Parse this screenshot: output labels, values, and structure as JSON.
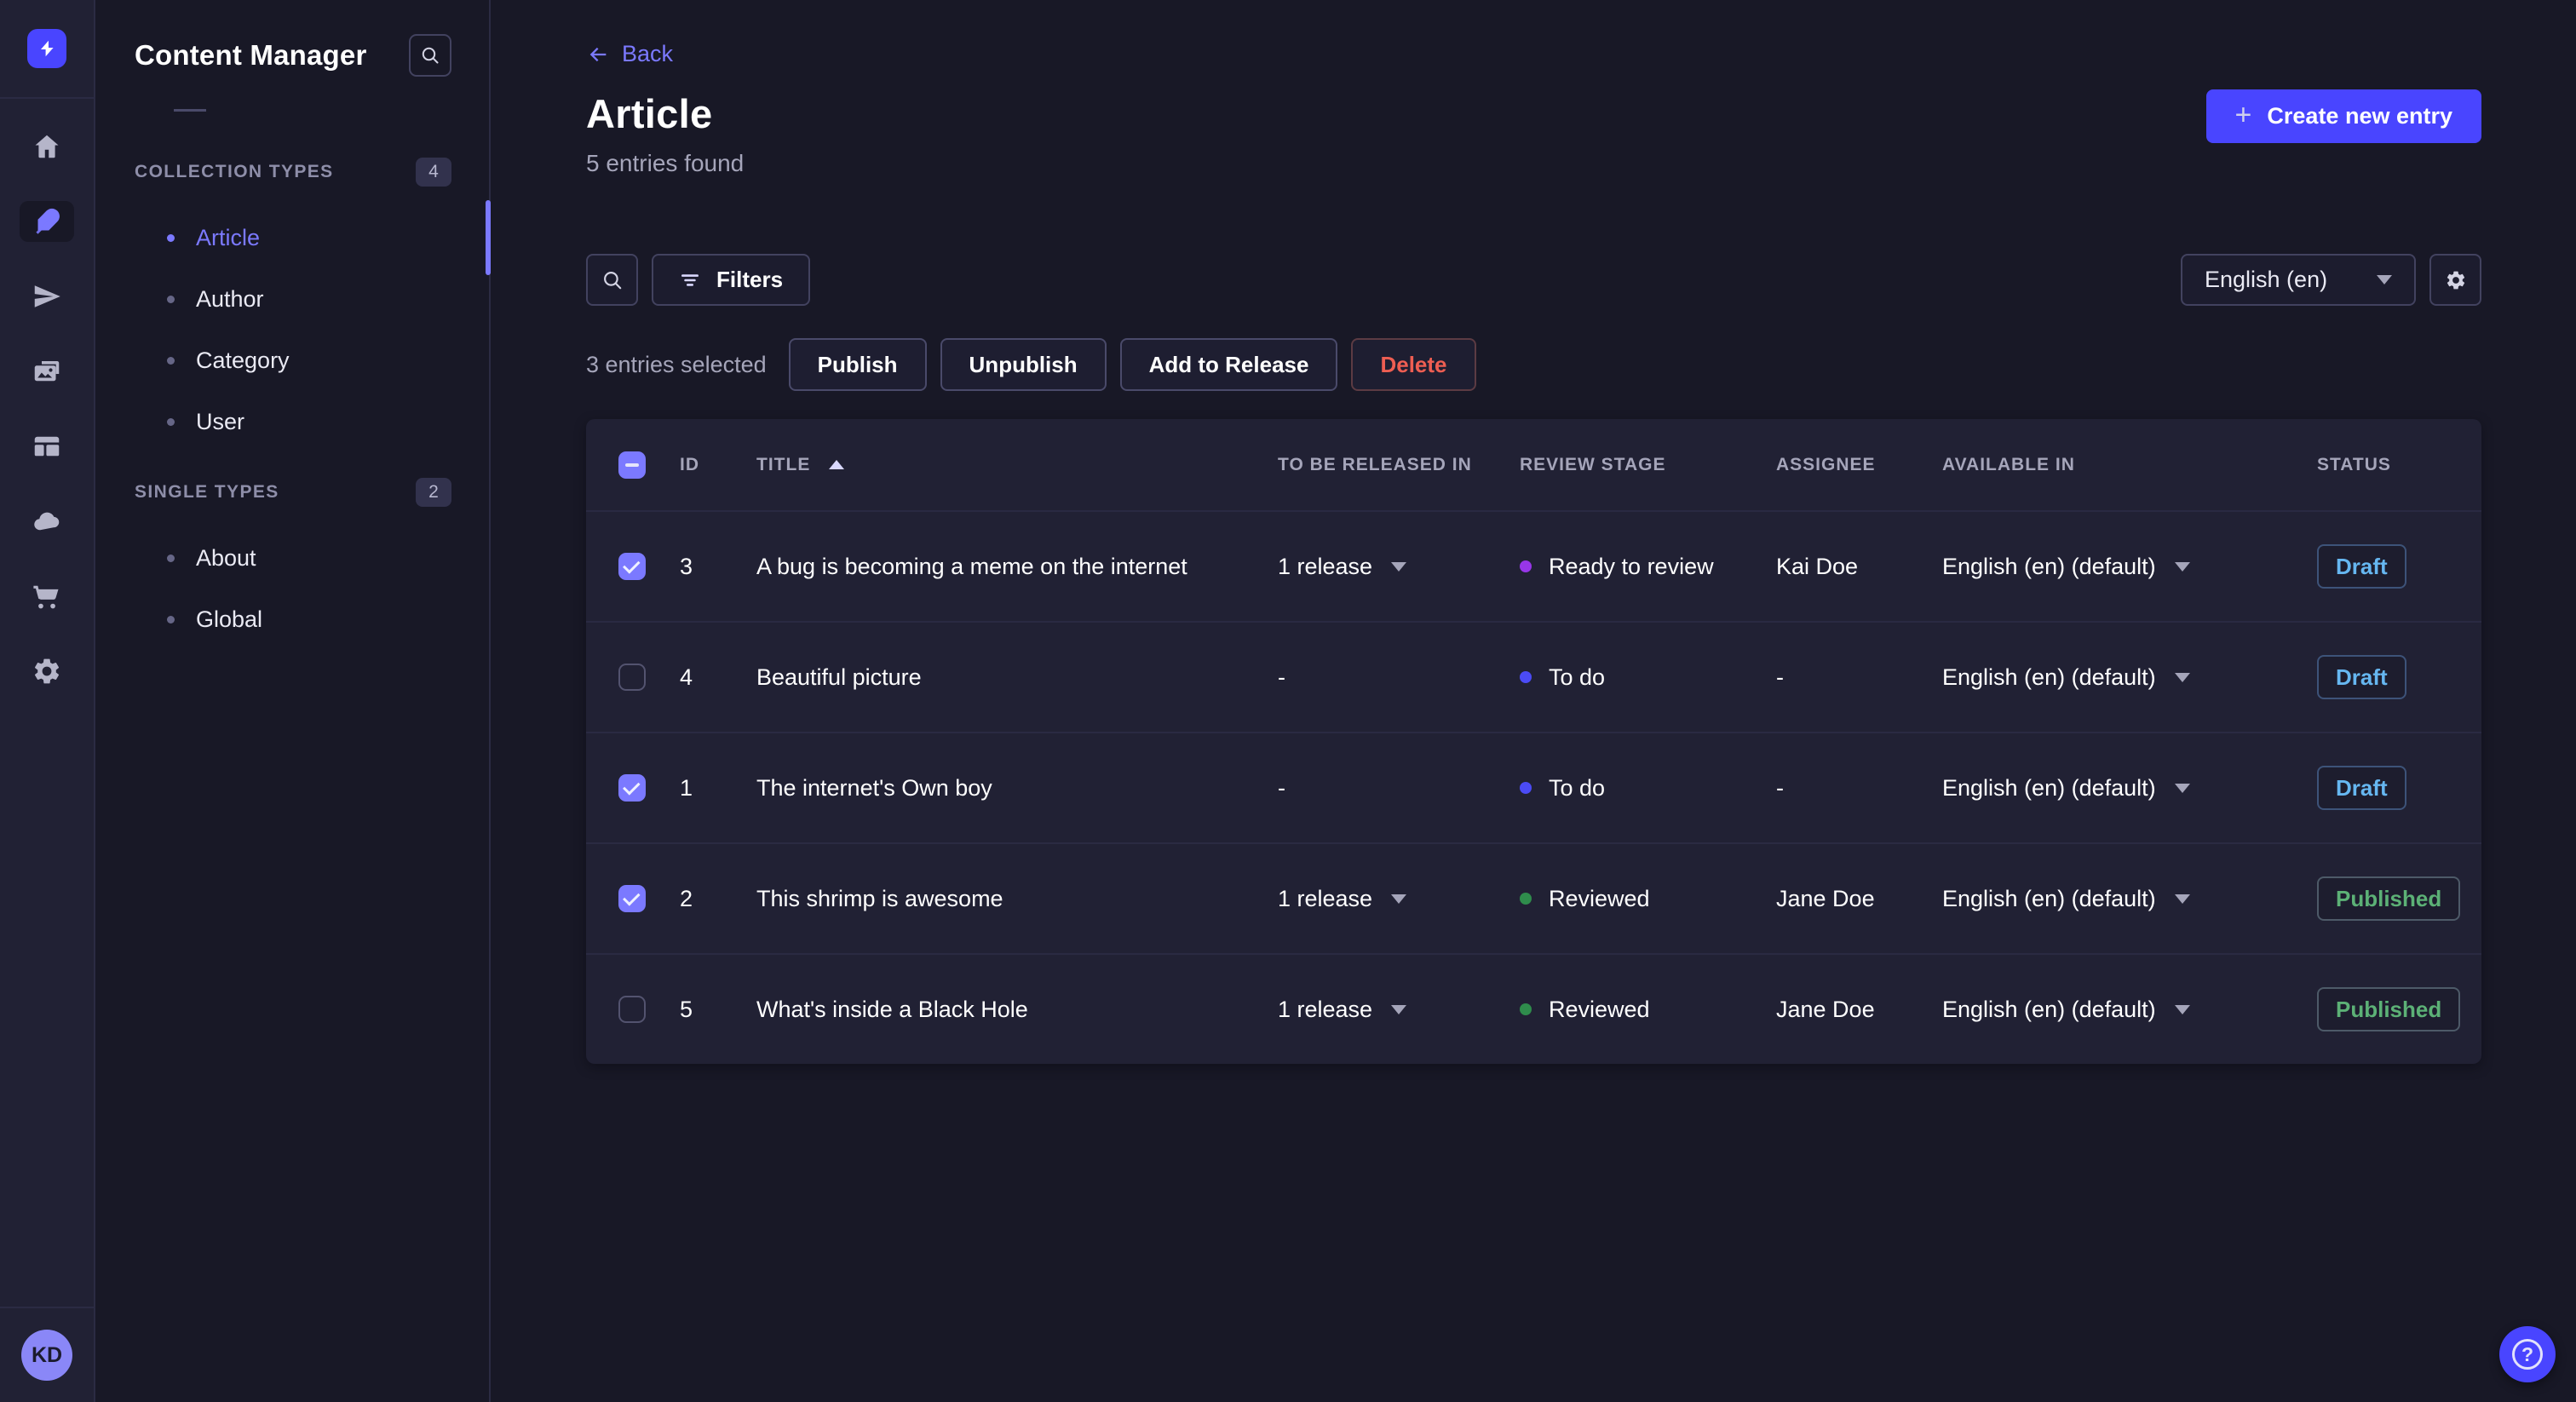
{
  "colors": {
    "accent": "#4945ff",
    "accent_light": "#7b79ff",
    "page_bg": "#181826",
    "panel_bg": "#212134",
    "danger": "#ee5e52",
    "success": "#5cb176",
    "draft_blue": "#66b7f1"
  },
  "primary_nav": {
    "logo_icon": "strapi-logo",
    "items": [
      {
        "icon": "home-icon",
        "active": false
      },
      {
        "icon": "content-manager-feather-icon",
        "active": true
      },
      {
        "icon": "paper-plane-icon",
        "active": false
      },
      {
        "icon": "media-library-icon",
        "active": false
      },
      {
        "icon": "content-type-builder-icon",
        "active": false
      },
      {
        "icon": "cloud-icon",
        "active": false
      },
      {
        "icon": "marketplace-cart-icon",
        "active": false
      },
      {
        "icon": "settings-gear-icon",
        "active": false
      }
    ],
    "avatar_initials": "KD"
  },
  "secondary_nav": {
    "title": "Content Manager",
    "sections": [
      {
        "label": "COLLECTION TYPES",
        "badge": "4",
        "items": [
          {
            "label": "Article",
            "active": true
          },
          {
            "label": "Author",
            "active": false
          },
          {
            "label": "Category",
            "active": false
          },
          {
            "label": "User",
            "active": false
          }
        ]
      },
      {
        "label": "SINGLE TYPES",
        "badge": "2",
        "items": [
          {
            "label": "About",
            "active": false
          },
          {
            "label": "Global",
            "active": false
          }
        ]
      }
    ]
  },
  "header": {
    "back_label": "Back",
    "title": "Article",
    "subtitle": "5 entries found",
    "create_button_label": "Create new entry"
  },
  "toolbar": {
    "filters_label": "Filters",
    "locale_value": "English (en)"
  },
  "selection": {
    "summary": "3 entries selected",
    "actions": [
      {
        "label": "Publish"
      },
      {
        "label": "Unpublish"
      },
      {
        "label": "Add to Release"
      },
      {
        "label": "Delete",
        "danger": true
      }
    ]
  },
  "table": {
    "columns": [
      "ID",
      "TITLE",
      "TO BE RELEASED IN",
      "REVIEW STAGE",
      "ASSIGNEE",
      "AVAILABLE IN",
      "STATUS"
    ],
    "sorted_column": "TITLE",
    "sort_direction": "ascending",
    "rows": [
      {
        "checked": true,
        "id": "3",
        "title": "A bug is becoming a meme on the internet",
        "release": {
          "label": "1 release",
          "caret": true
        },
        "review": {
          "label": "Ready to review",
          "dot": "#9736e8"
        },
        "assignee": "Kai Doe",
        "available": "English (en) (default)",
        "status": {
          "label": "Draft",
          "color": "#66b7f1",
          "border": "#3d5379"
        }
      },
      {
        "checked": false,
        "id": "4",
        "title": "Beautiful picture",
        "release": {
          "label": "-",
          "caret": false
        },
        "review": {
          "label": "To do",
          "dot": "#4b4bf5"
        },
        "assignee": "-",
        "available": "English (en) (default)",
        "status": {
          "label": "Draft",
          "color": "#66b7f1",
          "border": "#3d5379"
        }
      },
      {
        "checked": true,
        "id": "1",
        "title": "The internet's Own boy",
        "release": {
          "label": "-",
          "caret": false
        },
        "review": {
          "label": "To do",
          "dot": "#4b4bf5"
        },
        "assignee": "-",
        "available": "English (en) (default)",
        "status": {
          "label": "Draft",
          "color": "#66b7f1",
          "border": "#3d5379"
        }
      },
      {
        "checked": true,
        "id": "2",
        "title": "This shrimp is awesome",
        "release": {
          "label": "1 release",
          "caret": true
        },
        "review": {
          "label": "Reviewed",
          "dot": "#2f8c4c"
        },
        "assignee": "Jane Doe",
        "available": "English (en) (default)",
        "status": {
          "label": "Published",
          "color": "#5cb176",
          "border": "#4d5a68"
        }
      },
      {
        "checked": false,
        "id": "5",
        "title": "What's inside a Black Hole",
        "release": {
          "label": "1 release",
          "caret": true
        },
        "review": {
          "label": "Reviewed",
          "dot": "#2f8c4c"
        },
        "assignee": "Jane Doe",
        "available": "English (en) (default)",
        "status": {
          "label": "Published",
          "color": "#5cb176",
          "border": "#4d5a68"
        }
      }
    ]
  },
  "help_button": {
    "icon": "?"
  }
}
